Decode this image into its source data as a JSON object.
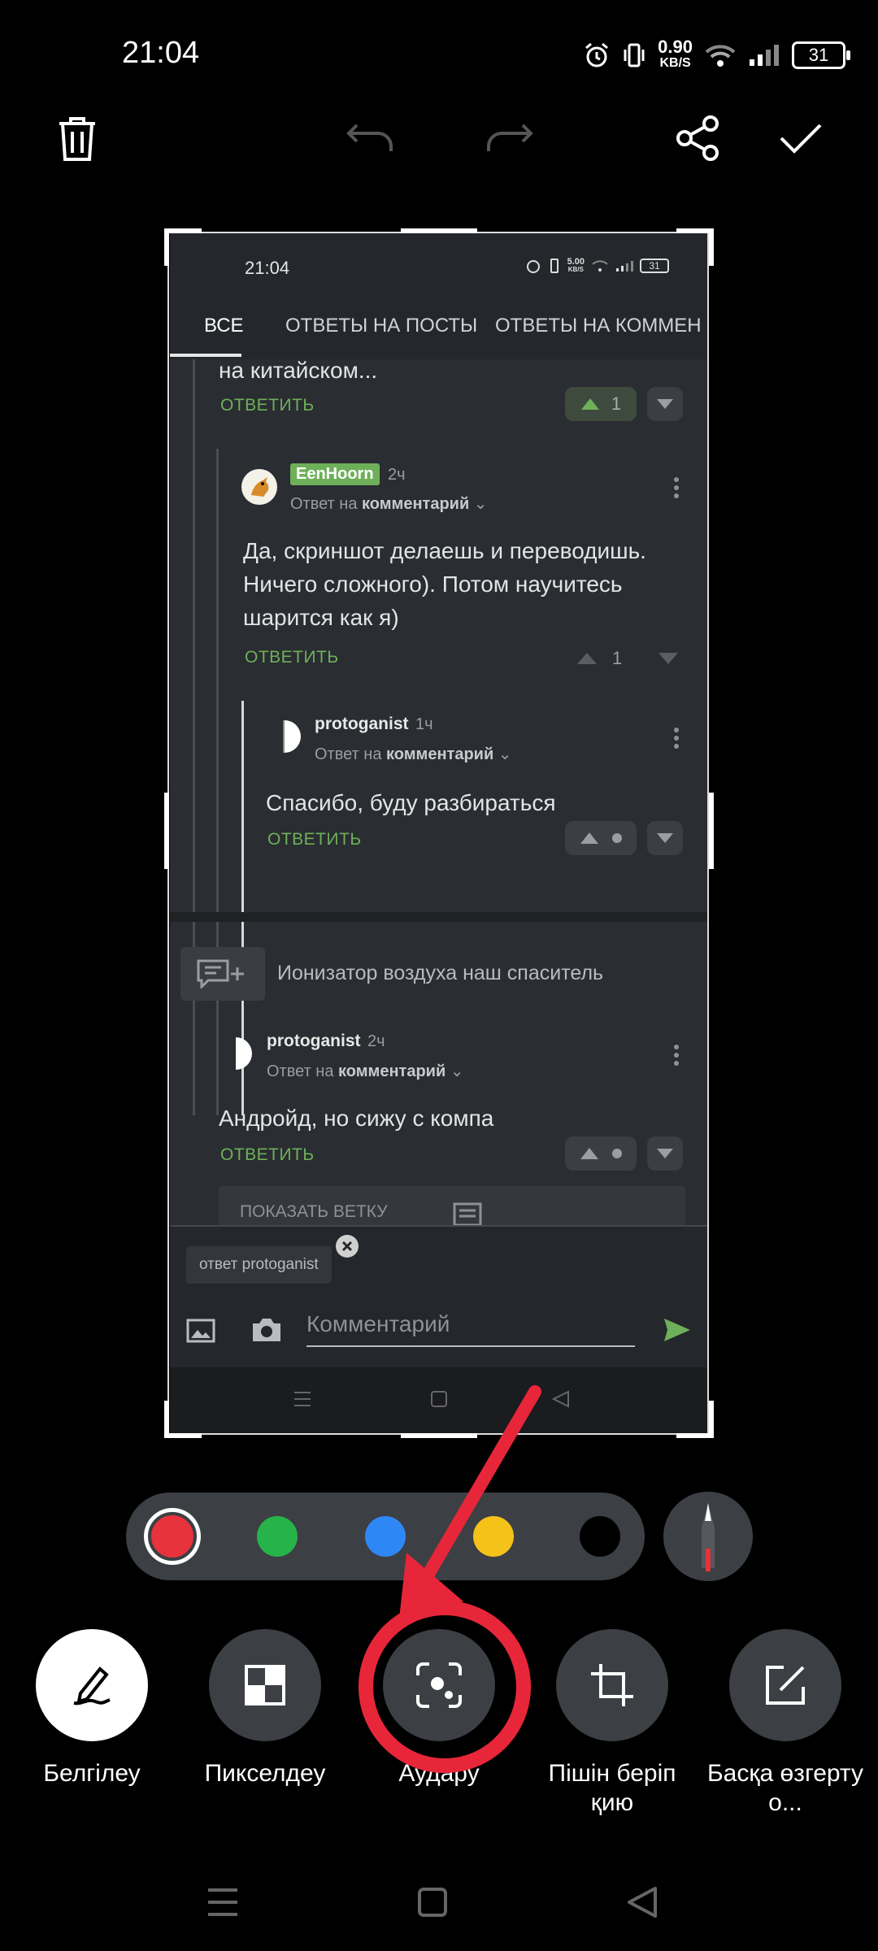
{
  "status_bar": {
    "time": "21:04",
    "speed_value": "0.90",
    "speed_unit": "KB/S",
    "battery": "31"
  },
  "screenshot": {
    "status": {
      "time": "21:04",
      "speed_value": "5.00",
      "speed_unit": "KB/S",
      "battery": "31"
    },
    "tabs": [
      "ВСЕ",
      "ОТВЕТЫ НА ПОСТЫ",
      "ОТВЕТЫ НА КОММЕН"
    ],
    "partial_text": "на китайском...",
    "reply_label": "ОТВЕТИТЬ",
    "reply_prefix": "Ответ на",
    "reply_target": "комментарий",
    "comment1": {
      "score": "1"
    },
    "comment2": {
      "author": "EenHoorn",
      "age": "2ч",
      "text": "Да, скриншот делаешь и переводишь. Ничего сложного). Потом научитесь шарится как я)",
      "score": "1"
    },
    "comment3": {
      "author": "protoganist",
      "age": "1ч",
      "text": "Спасибо, буду разбираться"
    },
    "post_title": "Ионизатор воздуха наш спаситель",
    "comment4": {
      "author": "protoganist",
      "age": "2ч",
      "text": "Андройд, но сижу с компа"
    },
    "show_thread": "ПОКАЗАТЬ ВЕТКУ",
    "reply_chip": "ответ protoganist",
    "comment_placeholder": "Комментарий"
  },
  "palette": {
    "colors": [
      "#e8323c",
      "#26b34a",
      "#2f87f5",
      "#f5c21a",
      "#000000"
    ],
    "selected": "#e8323c"
  },
  "tools": [
    {
      "label": "Белгілеу",
      "icon": "pen-icon"
    },
    {
      "label": "Пикселдеу",
      "icon": "pixelate-icon"
    },
    {
      "label": "Аудару",
      "icon": "scan-translate-icon"
    },
    {
      "label": "Пішін беріп қию",
      "icon": "crop-icon"
    },
    {
      "label": "Басқа өзгерту о...",
      "icon": "edit-icon"
    }
  ],
  "annotation_color": "#e8263a"
}
